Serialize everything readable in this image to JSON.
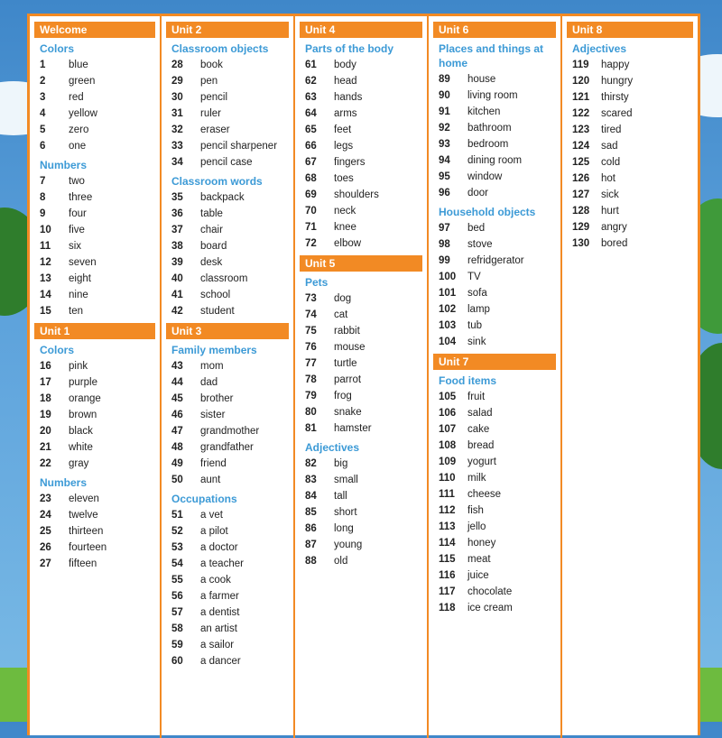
{
  "columns": [
    {
      "blocks": [
        {
          "header": "Welcome",
          "sections": [
            {
              "title": "Colors",
              "items": [
                {
                  "n": "1",
                  "w": "blue"
                },
                {
                  "n": "2",
                  "w": "green"
                },
                {
                  "n": "3",
                  "w": "red"
                },
                {
                  "n": "4",
                  "w": "yellow"
                },
                {
                  "n": "5",
                  "w": "zero"
                },
                {
                  "n": "6",
                  "w": "one"
                }
              ]
            },
            {
              "title": "Numbers",
              "items": [
                {
                  "n": "7",
                  "w": "two"
                },
                {
                  "n": "8",
                  "w": "three"
                },
                {
                  "n": "9",
                  "w": "four"
                },
                {
                  "n": "10",
                  "w": "five"
                },
                {
                  "n": "11",
                  "w": "six"
                },
                {
                  "n": "12",
                  "w": "seven"
                },
                {
                  "n": "13",
                  "w": "eight"
                },
                {
                  "n": "14",
                  "w": "nine"
                },
                {
                  "n": "15",
                  "w": "ten"
                }
              ]
            }
          ]
        },
        {
          "header": "Unit 1",
          "sections": [
            {
              "title": "Colors",
              "items": [
                {
                  "n": "16",
                  "w": "pink"
                },
                {
                  "n": "17",
                  "w": "purple"
                },
                {
                  "n": "18",
                  "w": "orange"
                },
                {
                  "n": "19",
                  "w": "brown"
                },
                {
                  "n": "20",
                  "w": "black"
                },
                {
                  "n": "21",
                  "w": "white"
                },
                {
                  "n": "22",
                  "w": "gray"
                }
              ]
            },
            {
              "title": "Numbers",
              "items": [
                {
                  "n": "23",
                  "w": "eleven"
                },
                {
                  "n": "24",
                  "w": "twelve"
                },
                {
                  "n": "25",
                  "w": "thirteen"
                },
                {
                  "n": "26",
                  "w": "fourteen"
                },
                {
                  "n": "27",
                  "w": "fifteen"
                }
              ]
            }
          ]
        }
      ]
    },
    {
      "blocks": [
        {
          "header": "Unit 2",
          "sections": [
            {
              "title": "Classroom objects",
              "items": [
                {
                  "n": "28",
                  "w": "book"
                },
                {
                  "n": "29",
                  "w": "pen"
                },
                {
                  "n": "30",
                  "w": "pencil"
                },
                {
                  "n": "31",
                  "w": "ruler"
                },
                {
                  "n": "32",
                  "w": "eraser"
                },
                {
                  "n": "33",
                  "w": "pencil sharpener"
                },
                {
                  "n": "34",
                  "w": "pencil case"
                }
              ]
            },
            {
              "title": "Classroom words",
              "items": [
                {
                  "n": "35",
                  "w": "backpack"
                },
                {
                  "n": "36",
                  "w": "table"
                },
                {
                  "n": "37",
                  "w": "chair"
                },
                {
                  "n": "38",
                  "w": "board"
                },
                {
                  "n": "39",
                  "w": "desk"
                },
                {
                  "n": "40",
                  "w": "classroom"
                },
                {
                  "n": "41",
                  "w": "school"
                },
                {
                  "n": "42",
                  "w": "student"
                }
              ]
            }
          ]
        },
        {
          "header": "Unit 3",
          "sections": [
            {
              "title": "Family members",
              "items": [
                {
                  "n": "43",
                  "w": "mom"
                },
                {
                  "n": "44",
                  "w": "dad"
                },
                {
                  "n": "45",
                  "w": "brother"
                },
                {
                  "n": "46",
                  "w": "sister"
                },
                {
                  "n": "47",
                  "w": "grandmother"
                },
                {
                  "n": "48",
                  "w": "grandfather"
                },
                {
                  "n": "49",
                  "w": "friend"
                },
                {
                  "n": "50",
                  "w": "aunt"
                }
              ]
            },
            {
              "title": "Occupations",
              "items": [
                {
                  "n": "51",
                  "w": "a vet"
                },
                {
                  "n": "52",
                  "w": "a pilot"
                },
                {
                  "n": "53",
                  "w": "a doctor"
                },
                {
                  "n": "54",
                  "w": "a teacher"
                },
                {
                  "n": "55",
                  "w": "a cook"
                },
                {
                  "n": "56",
                  "w": "a farmer"
                },
                {
                  "n": "57",
                  "w": "a dentist"
                },
                {
                  "n": "58",
                  "w": "an artist"
                },
                {
                  "n": "59",
                  "w": "a sailor"
                },
                {
                  "n": "60",
                  "w": "a dancer"
                }
              ]
            }
          ]
        }
      ]
    },
    {
      "blocks": [
        {
          "header": "Unit 4",
          "sections": [
            {
              "title": "Parts of the body",
              "items": [
                {
                  "n": "61",
                  "w": "body"
                },
                {
                  "n": "62",
                  "w": "head"
                },
                {
                  "n": "63",
                  "w": "hands"
                },
                {
                  "n": "64",
                  "w": "arms"
                },
                {
                  "n": "65",
                  "w": "feet"
                },
                {
                  "n": "66",
                  "w": "legs"
                },
                {
                  "n": "67",
                  "w": "fingers"
                },
                {
                  "n": "68",
                  "w": "toes"
                },
                {
                  "n": "69",
                  "w": "shoulders"
                },
                {
                  "n": "70",
                  "w": "neck"
                },
                {
                  "n": "71",
                  "w": "knee"
                },
                {
                  "n": "72",
                  "w": "elbow"
                }
              ]
            }
          ]
        },
        {
          "header": "Unit 5",
          "sections": [
            {
              "title": "Pets",
              "items": [
                {
                  "n": "73",
                  "w": "dog"
                },
                {
                  "n": "74",
                  "w": "cat"
                },
                {
                  "n": "75",
                  "w": "rabbit"
                },
                {
                  "n": "76",
                  "w": "mouse"
                },
                {
                  "n": "77",
                  "w": "turtle"
                },
                {
                  "n": "78",
                  "w": "parrot"
                },
                {
                  "n": "79",
                  "w": "frog"
                },
                {
                  "n": "80",
                  "w": "snake"
                },
                {
                  "n": "81",
                  "w": "hamster"
                }
              ]
            },
            {
              "title": "Adjectives",
              "items": [
                {
                  "n": "82",
                  "w": "big"
                },
                {
                  "n": "83",
                  "w": "small"
                },
                {
                  "n": "84",
                  "w": "tall"
                },
                {
                  "n": "85",
                  "w": "short"
                },
                {
                  "n": "86",
                  "w": "long"
                },
                {
                  "n": "87",
                  "w": "young"
                },
                {
                  "n": "88",
                  "w": "old"
                }
              ]
            }
          ]
        }
      ]
    },
    {
      "blocks": [
        {
          "header": "Unit 6",
          "sections": [
            {
              "title": "Places and things at home",
              "items": [
                {
                  "n": "89",
                  "w": "house"
                },
                {
                  "n": "90",
                  "w": "living room"
                },
                {
                  "n": "91",
                  "w": "kitchen"
                },
                {
                  "n": "92",
                  "w": "bathroom"
                },
                {
                  "n": "93",
                  "w": "bedroom"
                },
                {
                  "n": "94",
                  "w": "dining room"
                },
                {
                  "n": "95",
                  "w": "window"
                },
                {
                  "n": "96",
                  "w": "door"
                }
              ]
            },
            {
              "title": "Household objects",
              "items": [
                {
                  "n": "97",
                  "w": "bed"
                },
                {
                  "n": "98",
                  "w": "stove"
                },
                {
                  "n": "99",
                  "w": "refridgerator"
                },
                {
                  "n": "100",
                  "w": "TV"
                },
                {
                  "n": "101",
                  "w": "sofa"
                },
                {
                  "n": "102",
                  "w": "lamp"
                },
                {
                  "n": "103",
                  "w": "tub"
                },
                {
                  "n": "104",
                  "w": "sink"
                }
              ]
            }
          ]
        },
        {
          "header": "Unit 7",
          "sections": [
            {
              "title": "Food items",
              "items": [
                {
                  "n": "105",
                  "w": "fruit"
                },
                {
                  "n": "106",
                  "w": "salad"
                },
                {
                  "n": "107",
                  "w": "cake"
                },
                {
                  "n": "108",
                  "w": "bread"
                },
                {
                  "n": "109",
                  "w": "yogurt"
                },
                {
                  "n": "110",
                  "w": "milk"
                },
                {
                  "n": "111",
                  "w": "cheese"
                },
                {
                  "n": "112",
                  "w": "fish"
                },
                {
                  "n": "113",
                  "w": "jello"
                },
                {
                  "n": "114",
                  "w": "honey"
                },
                {
                  "n": "115",
                  "w": "meat"
                },
                {
                  "n": "116",
                  "w": "juice"
                },
                {
                  "n": "117",
                  "w": "chocolate"
                },
                {
                  "n": "118",
                  "w": "ice cream"
                }
              ]
            }
          ]
        }
      ]
    },
    {
      "blocks": [
        {
          "header": "Unit 8",
          "sections": [
            {
              "title": "Adjectives",
              "items": [
                {
                  "n": "119",
                  "w": "happy"
                },
                {
                  "n": "120",
                  "w": "hungry"
                },
                {
                  "n": "121",
                  "w": "thirsty"
                },
                {
                  "n": "122",
                  "w": "scared"
                },
                {
                  "n": "123",
                  "w": "tired"
                },
                {
                  "n": "124",
                  "w": "sad"
                },
                {
                  "n": "125",
                  "w": "cold"
                },
                {
                  "n": "126",
                  "w": "hot"
                },
                {
                  "n": "127",
                  "w": "sick"
                },
                {
                  "n": "128",
                  "w": "hurt"
                },
                {
                  "n": "129",
                  "w": "angry"
                },
                {
                  "n": "130",
                  "w": "bored"
                }
              ]
            }
          ]
        }
      ]
    }
  ],
  "colors": {
    "accent": "#f28a24",
    "section": "#3c9ad6",
    "text": "#222222"
  }
}
